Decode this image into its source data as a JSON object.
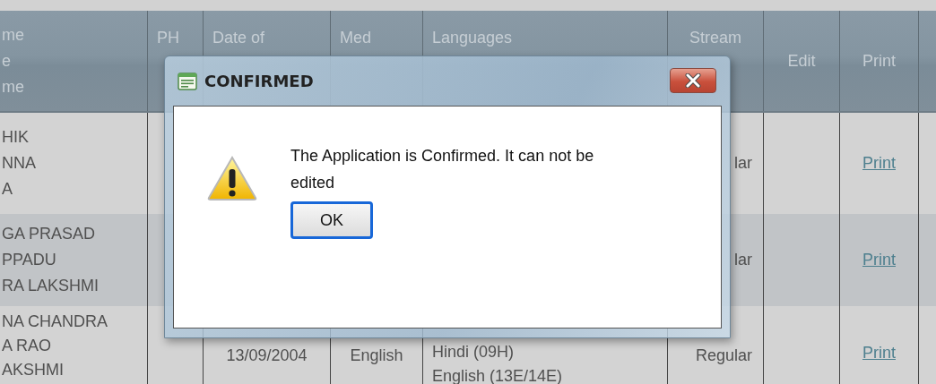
{
  "table": {
    "columns": [
      {
        "lines": [
          "me",
          "e",
          "me"
        ]
      },
      {
        "lines": [
          "PH"
        ]
      },
      {
        "lines": [
          "Date of"
        ]
      },
      {
        "lines": [
          "Med"
        ]
      },
      {
        "lines": [
          "Languages"
        ]
      },
      {
        "lines": [
          "Stream"
        ]
      },
      {
        "lines": [
          "Edit"
        ]
      },
      {
        "lines": [
          "Print"
        ]
      }
    ],
    "rows": [
      {
        "name": [
          "HIK",
          "NNA",
          "A"
        ],
        "stream": "lar",
        "print": "Print"
      },
      {
        "name": [
          "GA PRASAD",
          "PPADU",
          "RA LAKSHMI"
        ],
        "stream": "lar",
        "print": "Print"
      },
      {
        "name": [
          "NA CHANDRA",
          "A RAO",
          "AKSHMI"
        ],
        "date_of_birth": "13/09/2004",
        "medium": "English",
        "languages": [
          "Hindi (09H)",
          "English (13E/14E)"
        ],
        "stream": "Regular",
        "print": "Print"
      }
    ]
  },
  "dialog": {
    "title": "CONFIRMED",
    "message": "The Application is Confirmed. It can not be edited",
    "buttons": [
      {
        "label": "OK",
        "focused": true
      }
    ]
  }
}
